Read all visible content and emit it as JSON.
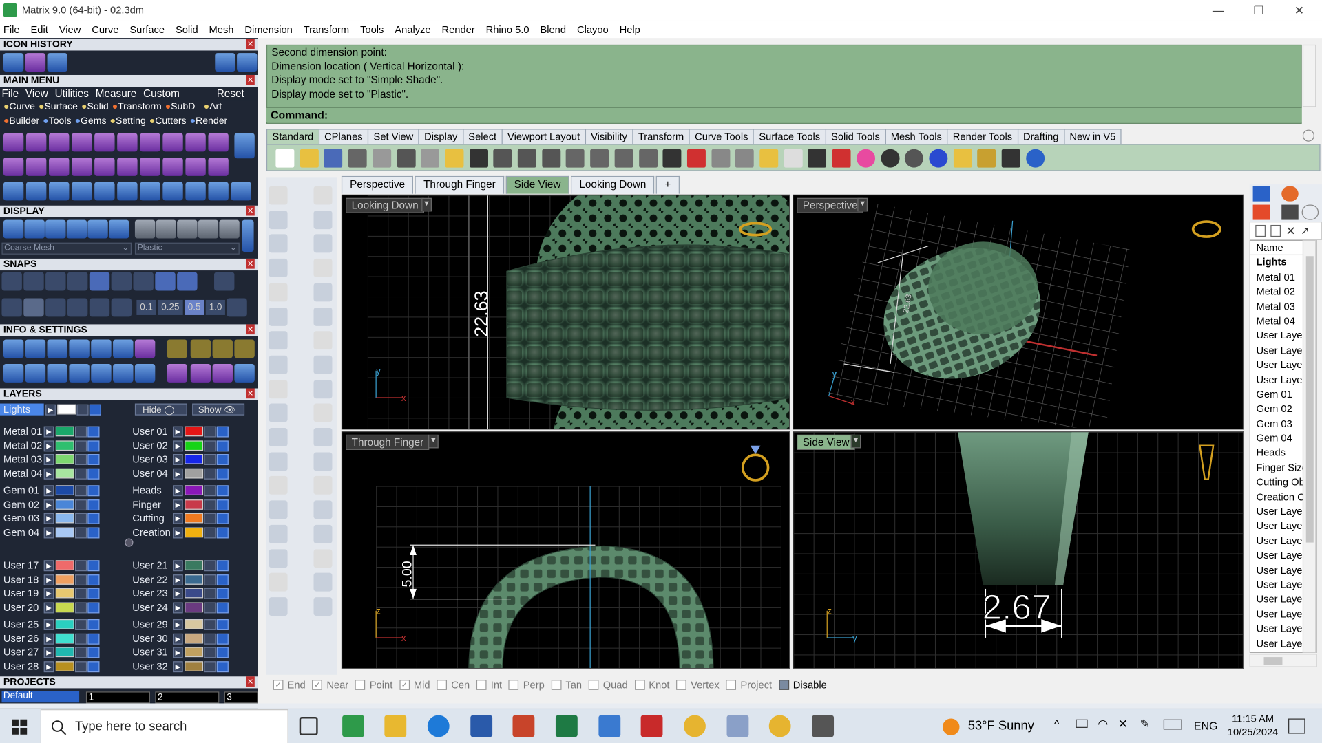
{
  "window": {
    "title": "Matrix 9.0 (64-bit) - 02.3dm"
  },
  "menu": [
    "File",
    "Edit",
    "View",
    "Curve",
    "Surface",
    "Solid",
    "Mesh",
    "Dimension",
    "Transform",
    "Tools",
    "Analyze",
    "Render",
    "Rhino 5.0",
    "Blend",
    "Clayoo",
    "Help"
  ],
  "left_panel": {
    "icon_history": "ICON HISTORY",
    "main_menu": "MAIN MENU",
    "main_menu_items": [
      "File",
      "View",
      "Utilities",
      "Measure",
      "Custom",
      "Reset"
    ],
    "categories_row1": [
      "Curve",
      "Surface",
      "Solid",
      "Transform",
      "SubD",
      "Art"
    ],
    "categories_row2": [
      "Builder",
      "Tools",
      "Gems",
      "Setting",
      "Cutters",
      "Render"
    ],
    "display": "DISPLAY",
    "display_mode_1": "Coarse Mesh",
    "display_mode_2": "Plastic",
    "snaps": "SNAPS",
    "snap_values": [
      "0.1",
      "0.25",
      "0.5",
      "1.0"
    ],
    "info_settings": "INFO & SETTINGS",
    "layers": "LAYERS",
    "layers_current": "Lights",
    "hide_label": "Hide",
    "show_label": "Show",
    "layers_left": [
      "Metal 01",
      "Metal 02",
      "Metal 03",
      "Metal 04",
      "Gem 01",
      "Gem 02",
      "Gem 03",
      "Gem 04",
      "User 17",
      "User 18",
      "User 19",
      "User 20",
      "User 25",
      "User 26",
      "User 27",
      "User 28"
    ],
    "layers_right": [
      "User 01",
      "User 02",
      "User 03",
      "User 04",
      "Heads",
      "Finger",
      "Cutting",
      "Creation",
      "User 21",
      "User 22",
      "User 23",
      "User 24",
      "User 29",
      "User 30",
      "User 31",
      "User 32"
    ],
    "layer_colors_left": [
      "#1aa86a",
      "#2fbf6f",
      "#7ed870",
      "#a8e6a0",
      "#1c4aa6",
      "#4a86d8",
      "#8ab8ee",
      "#a8c8f4",
      "#ef6a6a",
      "#f0a060",
      "#e8c870",
      "#c8d850",
      "#2ad0c0",
      "#40e0d0",
      "#20b8b0",
      "#b89020"
    ],
    "layer_colors_right": [
      "#e41616",
      "#16d416",
      "#1626e8",
      "#a0a0a0",
      "#8a18b8",
      "#c83a4a",
      "#f07a20",
      "#f0b010",
      "#3a7a60",
      "#3a6a90",
      "#3a4a8a",
      "#6a3a80",
      "#d8c8a0",
      "#c8a880",
      "#c0a060",
      "#a08040"
    ],
    "projects": "PROJECTS",
    "project_default": "Default",
    "project_pages": [
      "1",
      "2",
      "3"
    ]
  },
  "command": {
    "history": [
      "Second dimension point:",
      "Dimension location ( Vertical  Horizontal ):",
      "Display mode set to \"Simple Shade\".",
      "Display mode set to \"Plastic\"."
    ],
    "prompt": "Command:",
    "value": ""
  },
  "toolbar_tabs": [
    "Standard",
    "CPlanes",
    "Set View",
    "Display",
    "Select",
    "Viewport Layout",
    "Visibility",
    "Transform",
    "Curve Tools",
    "Surface Tools",
    "Solid Tools",
    "Mesh Tools",
    "Render Tools",
    "Drafting",
    "New in V5"
  ],
  "viewport_tabs": [
    "Perspective",
    "Through Finger",
    "Side View",
    "Looking Down"
  ],
  "viewport_tab_add": "+",
  "viewports": [
    {
      "label": "Looking Down",
      "dimension": "22.63",
      "axis_h": "x",
      "axis_v": "y"
    },
    {
      "label": "Perspective",
      "dimension": "22.63",
      "axis_h": "x",
      "axis_v": "y"
    },
    {
      "label": "Through Finger",
      "dimension": "5.00",
      "axis_h": "x",
      "axis_v": "z"
    },
    {
      "label": "Side View",
      "dimension": "2.67",
      "axis_h": "y",
      "axis_v": "z"
    }
  ],
  "right_panel": {
    "header": "Name",
    "items": [
      "Lights",
      "Metal 01",
      "Metal 02",
      "Metal 03",
      "Metal 04",
      "User Layer",
      "User Layer",
      "User Layer",
      "User Layer",
      "Gem 01",
      "Gem 02",
      "Gem 03",
      "Gem 04",
      "Heads",
      "Finger Size",
      "Cutting Obj",
      "Creation Cu",
      "User Layer",
      "User Layer",
      "User Layer",
      "User Layer",
      "User Layer",
      "User Layer",
      "User Layer",
      "User Layer",
      "User Layer",
      "User Layer"
    ]
  },
  "osnaps": [
    {
      "label": "End",
      "checked": true
    },
    {
      "label": "Near",
      "checked": true
    },
    {
      "label": "Point",
      "checked": false
    },
    {
      "label": "Mid",
      "checked": true
    },
    {
      "label": "Cen",
      "checked": false
    },
    {
      "label": "Int",
      "checked": false
    },
    {
      "label": "Perp",
      "checked": false
    },
    {
      "label": "Tan",
      "checked": false
    },
    {
      "label": "Quad",
      "checked": false
    },
    {
      "label": "Knot",
      "checked": false
    },
    {
      "label": "Vertex",
      "checked": false
    },
    {
      "label": "Project",
      "checked": false
    },
    {
      "label": "Disable",
      "checked": false
    }
  ],
  "taskbar": {
    "search_placeholder": "Type here to search",
    "weather": "53°F  Sunny",
    "lang": "ENG",
    "time": "11:15 AM",
    "date": "10/25/2024"
  },
  "colors": {
    "command_bg": "#8ab48c",
    "panel_bg": "#1f2634",
    "active_tab": "#8ab48c",
    "model": "#5f8a70"
  }
}
